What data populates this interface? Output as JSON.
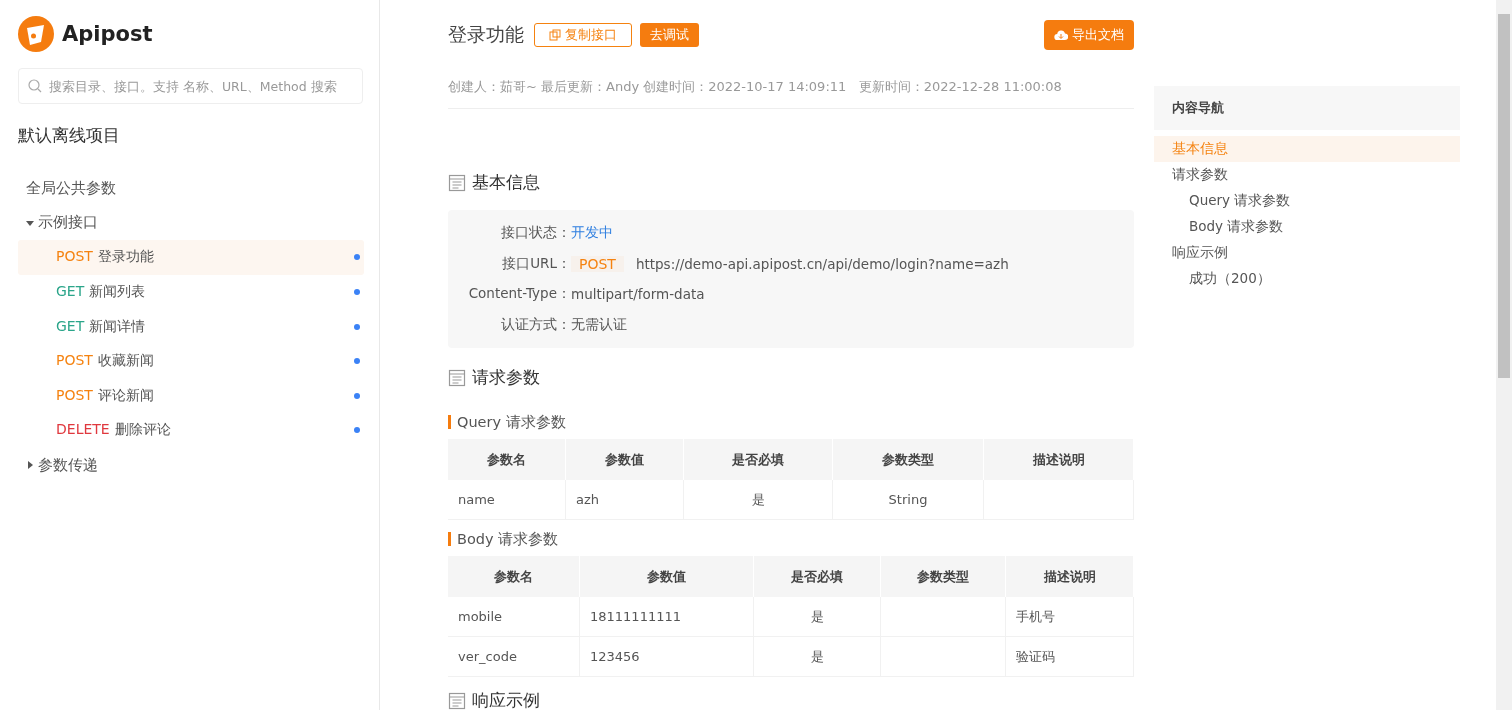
{
  "sidebar": {
    "logo": "Apipost",
    "search": {
      "placeholder": "搜索目录、接口。支持 名称、URL、Method 搜索"
    },
    "project": "默认离线项目",
    "tree": [
      {
        "label": "全局公共参数",
        "kind": "plain"
      },
      {
        "label": "示例接口",
        "kind": "folder",
        "expanded": true,
        "children": [
          {
            "method": "POST",
            "color": "#f5820f",
            "label": "登录功能",
            "selected": true
          },
          {
            "method": "GET",
            "color": "#2ba58a",
            "label": "新闻列表",
            "selected": false
          },
          {
            "method": "GET",
            "color": "#2ba58a",
            "label": "新闻详情",
            "selected": false
          },
          {
            "method": "POST",
            "color": "#f5820f",
            "label": "收藏新闻",
            "selected": false
          },
          {
            "method": "POST",
            "color": "#f5820f",
            "label": "评论新闻",
            "selected": false
          },
          {
            "method": "DELETE",
            "color": "#e0383e",
            "label": "删除评论",
            "selected": false
          }
        ]
      },
      {
        "label": "参数传递",
        "kind": "folder",
        "expanded": false
      }
    ]
  },
  "header": {
    "title": "登录功能",
    "copy_button": "复制接口",
    "debug_button": "去调试",
    "export_button": "导出文档",
    "meta": "创建人：茹哥~ 最后更新：Andy 创建时间：2022-10-17 14:09:11   更新时间：2022-12-28 11:00:08"
  },
  "basic_info": {
    "title": "基本信息",
    "status_label": "接口状态：",
    "status": "开发中",
    "url_label": "接口URL：",
    "method": "POST",
    "url": "https://demo-api.apipost.cn/api/demo/login?name=azh",
    "content_type_label": "Content-Type：",
    "content_type": "multipart/form-data",
    "auth_label": "认证方式：",
    "auth": "无需认证"
  },
  "request_params": {
    "title": "请求参数",
    "tables": [
      {
        "title": "Query 请求参数",
        "columns": [
          "参数名",
          "参数值",
          "是否必填",
          "参数类型",
          "描述说明"
        ],
        "rows": [
          [
            "name",
            "azh",
            "是",
            "String",
            ""
          ]
        ]
      },
      {
        "title": "Body 请求参数",
        "columns": [
          "参数名",
          "参数值",
          "是否必填",
          "参数类型",
          "描述说明"
        ],
        "rows": [
          [
            "mobile",
            "18111111111",
            "是",
            "",
            "手机号"
          ],
          [
            "ver_code",
            "123456",
            "是",
            "",
            "验证码"
          ]
        ]
      }
    ]
  },
  "response_example": {
    "title": "响应示例"
  },
  "content_nav": {
    "title": "内容导航",
    "items": [
      {
        "label": "基本信息",
        "selected": true
      },
      {
        "label": "请求参数",
        "selected": false,
        "children": [
          {
            "label": "Query 请求参数",
            "selected": false
          },
          {
            "label": "Body 请求参数",
            "selected": false
          }
        ]
      },
      {
        "label": "响应示例",
        "selected": false,
        "children": [
          {
            "label": "成功（200）",
            "selected": false
          }
        ]
      }
    ]
  }
}
